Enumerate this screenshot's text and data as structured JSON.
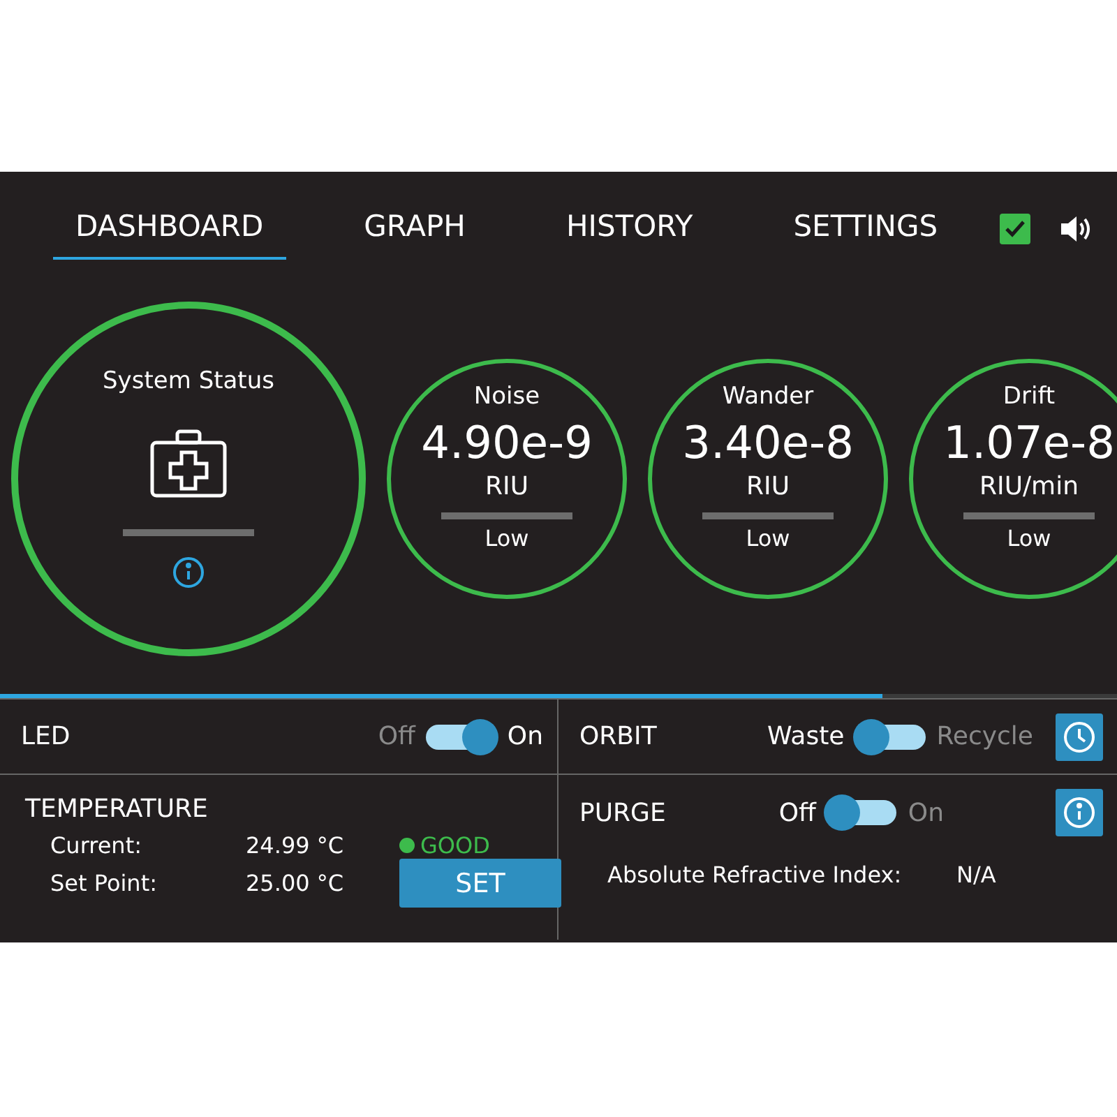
{
  "tabs": [
    {
      "label": "DASHBOARD",
      "selected": true
    },
    {
      "label": "GRAPH",
      "selected": false
    },
    {
      "label": "HISTORY",
      "selected": false
    },
    {
      "label": "SETTINGS",
      "selected": false
    }
  ],
  "status_check": {
    "checked": true
  },
  "system_status": {
    "title": "System Status"
  },
  "metrics": [
    {
      "name": "Noise",
      "value": "4.90e-9",
      "unit": "RIU",
      "rating": "Low"
    },
    {
      "name": "Wander",
      "value": "3.40e-8",
      "unit": "RIU",
      "rating": "Low"
    },
    {
      "name": "Drift",
      "value": "1.07e-8",
      "unit": "RIU/min",
      "rating": "Low"
    }
  ],
  "page_progress": {
    "level": 0.79
  },
  "led": {
    "label": "LED",
    "off_label": "Off",
    "on_label": "On",
    "on": true
  },
  "orbit": {
    "label": "ORBIT",
    "off_label": "Waste",
    "on_label": "Recycle",
    "on": false
  },
  "temperature": {
    "label": "TEMPERATURE",
    "rows": [
      {
        "label": "Current:",
        "value": "24.99 °C"
      },
      {
        "label": "Set Point:",
        "value": "25.00 °C"
      }
    ],
    "status": "GOOD",
    "button": "SET"
  },
  "purge": {
    "label": "PURGE",
    "off_label": "Off",
    "on_label": "On",
    "on": false
  },
  "refractive_index": {
    "label": "Absolute Refractive Index:",
    "value": "N/A"
  }
}
